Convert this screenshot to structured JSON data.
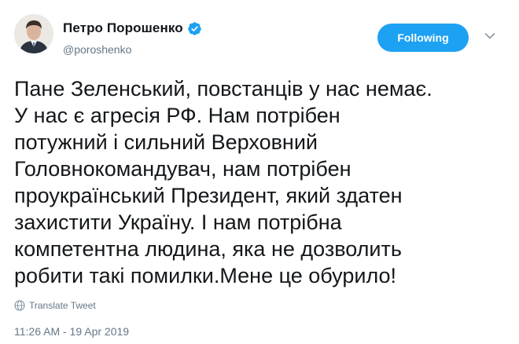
{
  "author": {
    "display_name": "Петро Порошенко",
    "handle": "@poroshenko",
    "verified": true,
    "avatar_icon": "profile-photo"
  },
  "follow_button": {
    "label": "Following",
    "color": "#1da1f2"
  },
  "menu": {
    "icon": "chevron-down-icon"
  },
  "tweet": {
    "lines": [
      "Пане Зеленський, повстанців у нас немає.",
      "У нас є агресія РФ. Нам потрібен",
      "потужний і сильний Верховний",
      "Головнокомандувач, нам потрібен",
      "проукраїнський Президент, який здатен",
      "захистити Україну. І нам потрібна",
      "компетентна людина, яка не дозволить",
      "робити такі помилки.Мене це обурило!"
    ]
  },
  "translate": {
    "label": "Translate Tweet",
    "icon": "globe-icon"
  },
  "timestamp": "11:26 AM - 19 Apr 2019",
  "colors": {
    "text": "#14171a",
    "secondary": "#657786",
    "accent": "#1da1f2"
  }
}
